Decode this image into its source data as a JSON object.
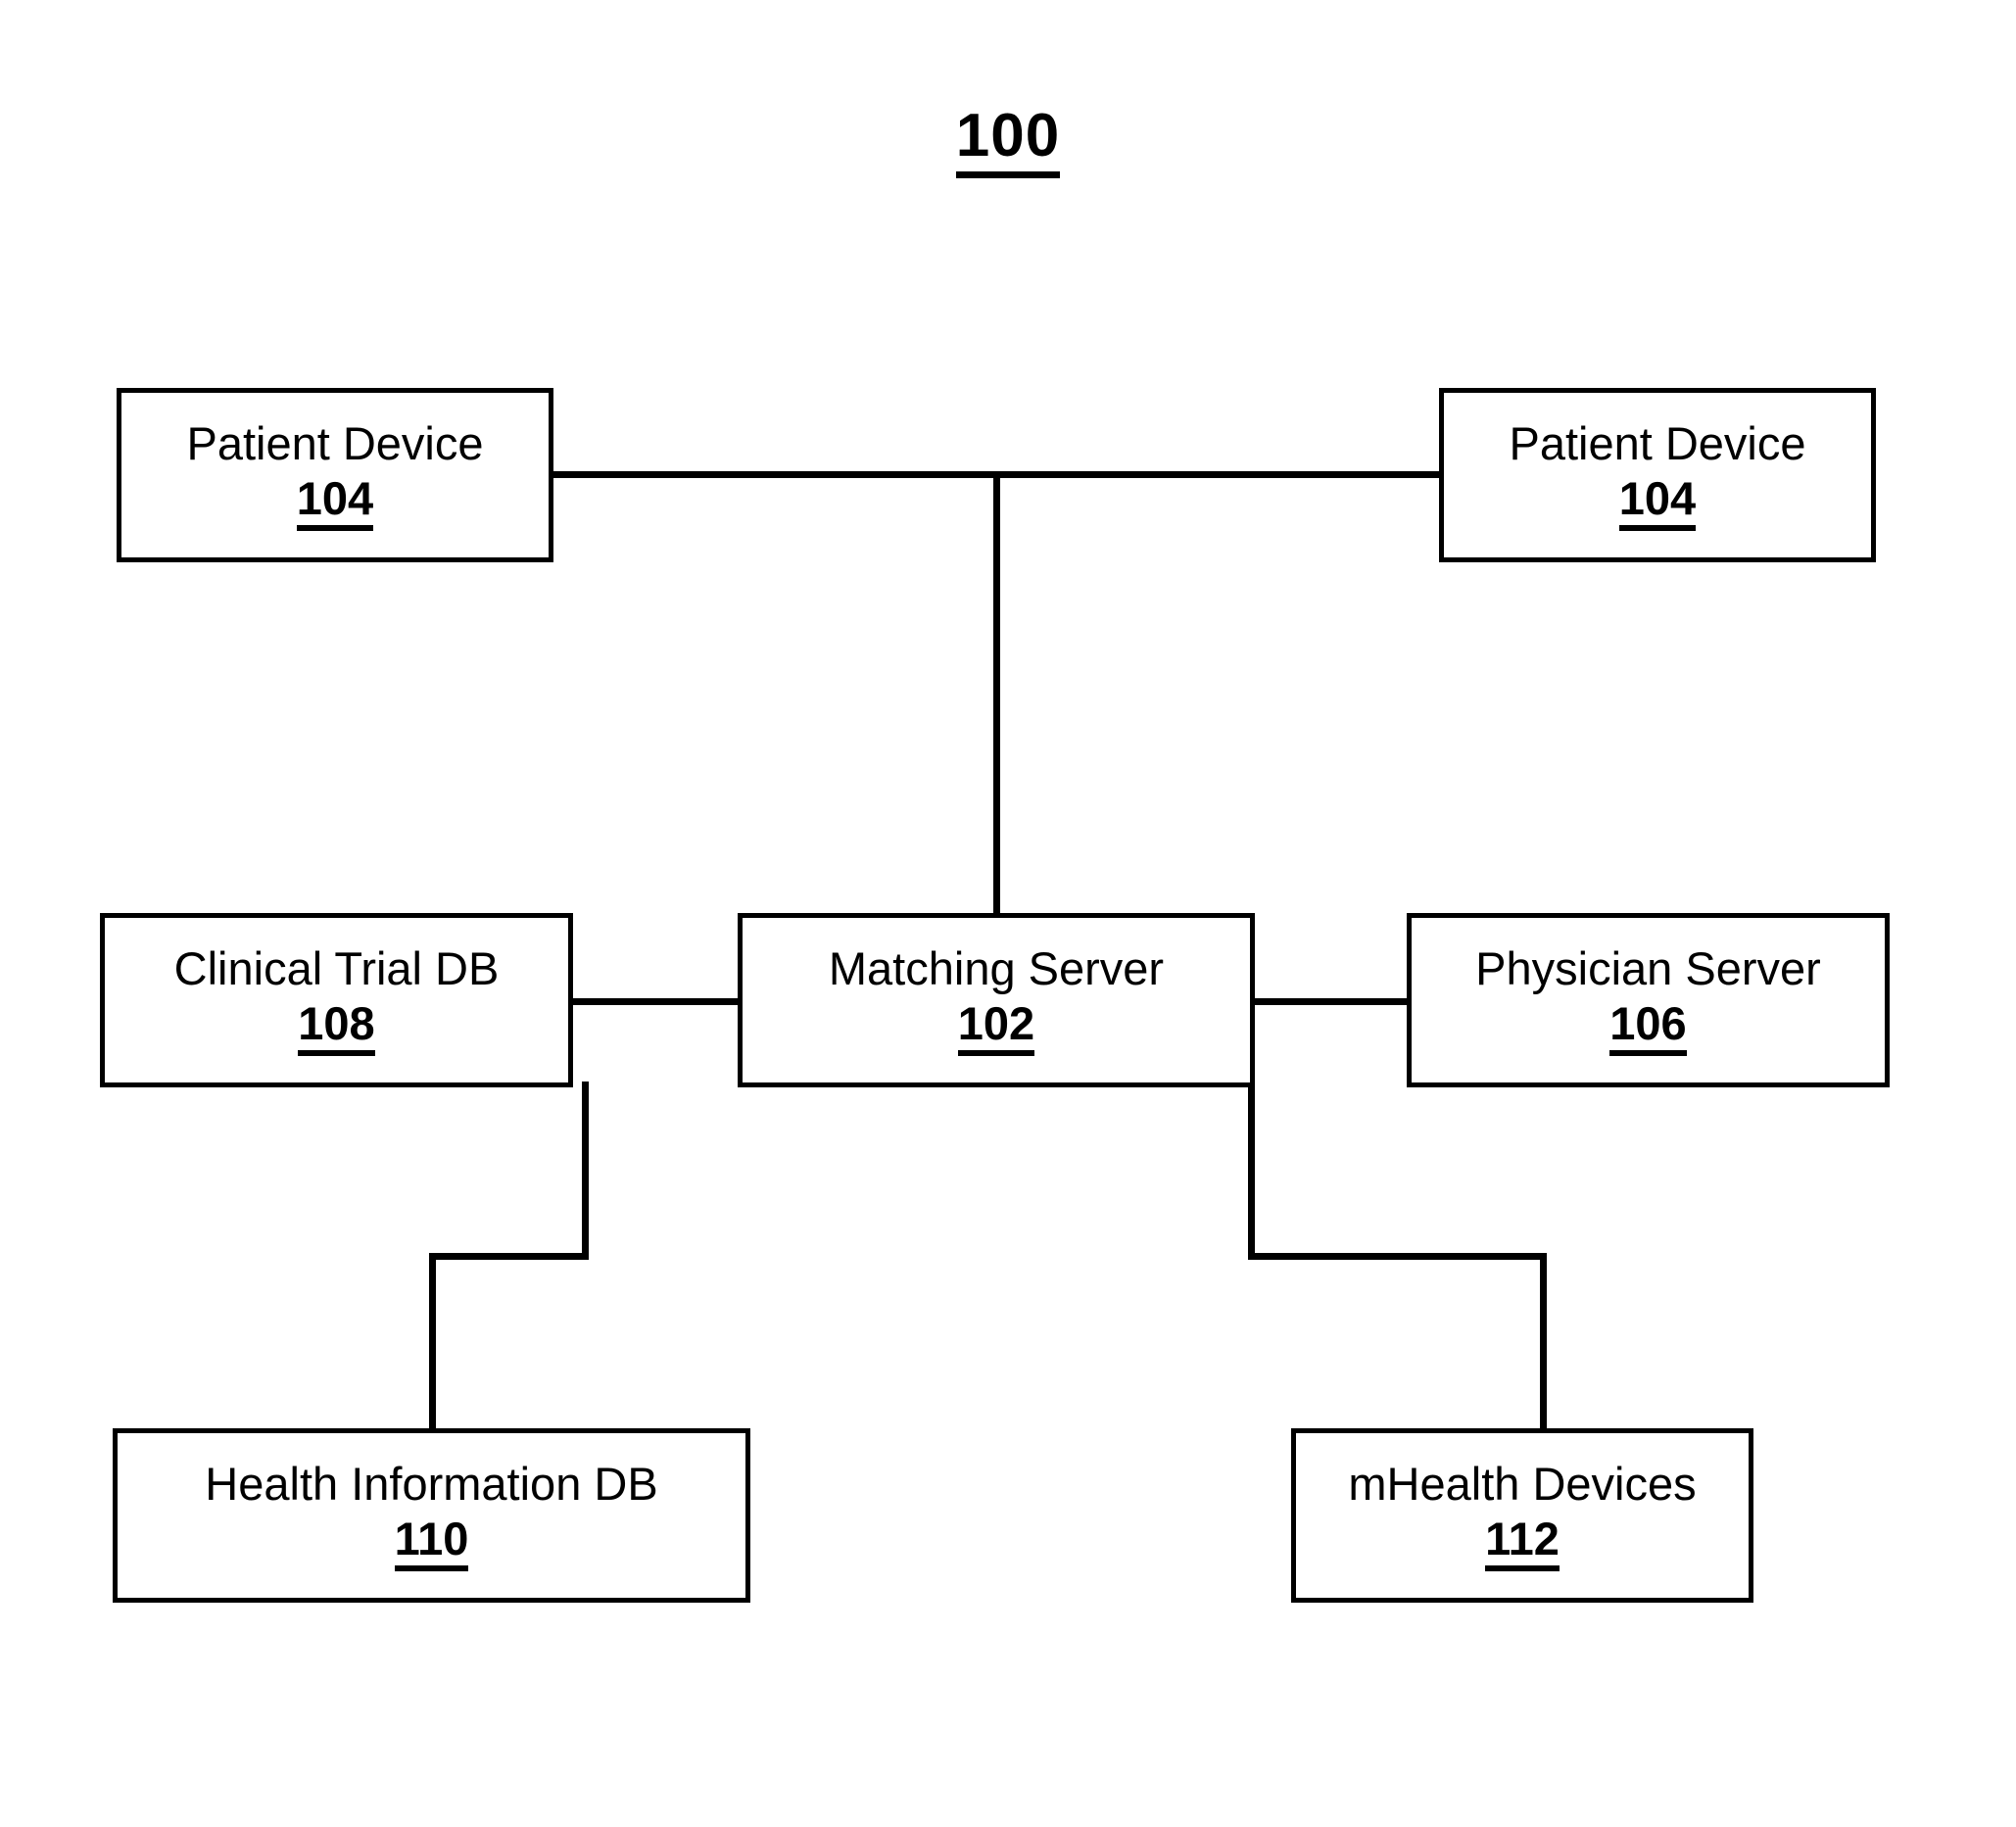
{
  "figure": {
    "title_number": "100"
  },
  "nodes": [
    {
      "id": "patient-device-left",
      "label": "Patient Device",
      "ref": "104"
    },
    {
      "id": "patient-device-right",
      "label": "Patient Device",
      "ref": "104"
    },
    {
      "id": "clinical-trial-db",
      "label": "Clinical Trial DB",
      "ref": "108"
    },
    {
      "id": "matching-server",
      "label": "Matching Server",
      "ref": "102"
    },
    {
      "id": "physician-server",
      "label": "Physician Server",
      "ref": "106"
    },
    {
      "id": "health-information-db",
      "label": "Health Information DB",
      "ref": "110"
    },
    {
      "id": "mhealth-devices",
      "label": "mHealth Devices",
      "ref": "112"
    }
  ],
  "connections": [
    {
      "from": "patient-device-left",
      "to": "patient-device-right"
    },
    {
      "from": "matching-server",
      "to": "patient-device-bus"
    },
    {
      "from": "clinical-trial-db",
      "to": "matching-server"
    },
    {
      "from": "matching-server",
      "to": "physician-server"
    },
    {
      "from": "matching-server",
      "to": "health-information-db"
    },
    {
      "from": "matching-server",
      "to": "mhealth-devices"
    }
  ],
  "colors": {
    "stroke": "#000000",
    "background": "#ffffff"
  }
}
